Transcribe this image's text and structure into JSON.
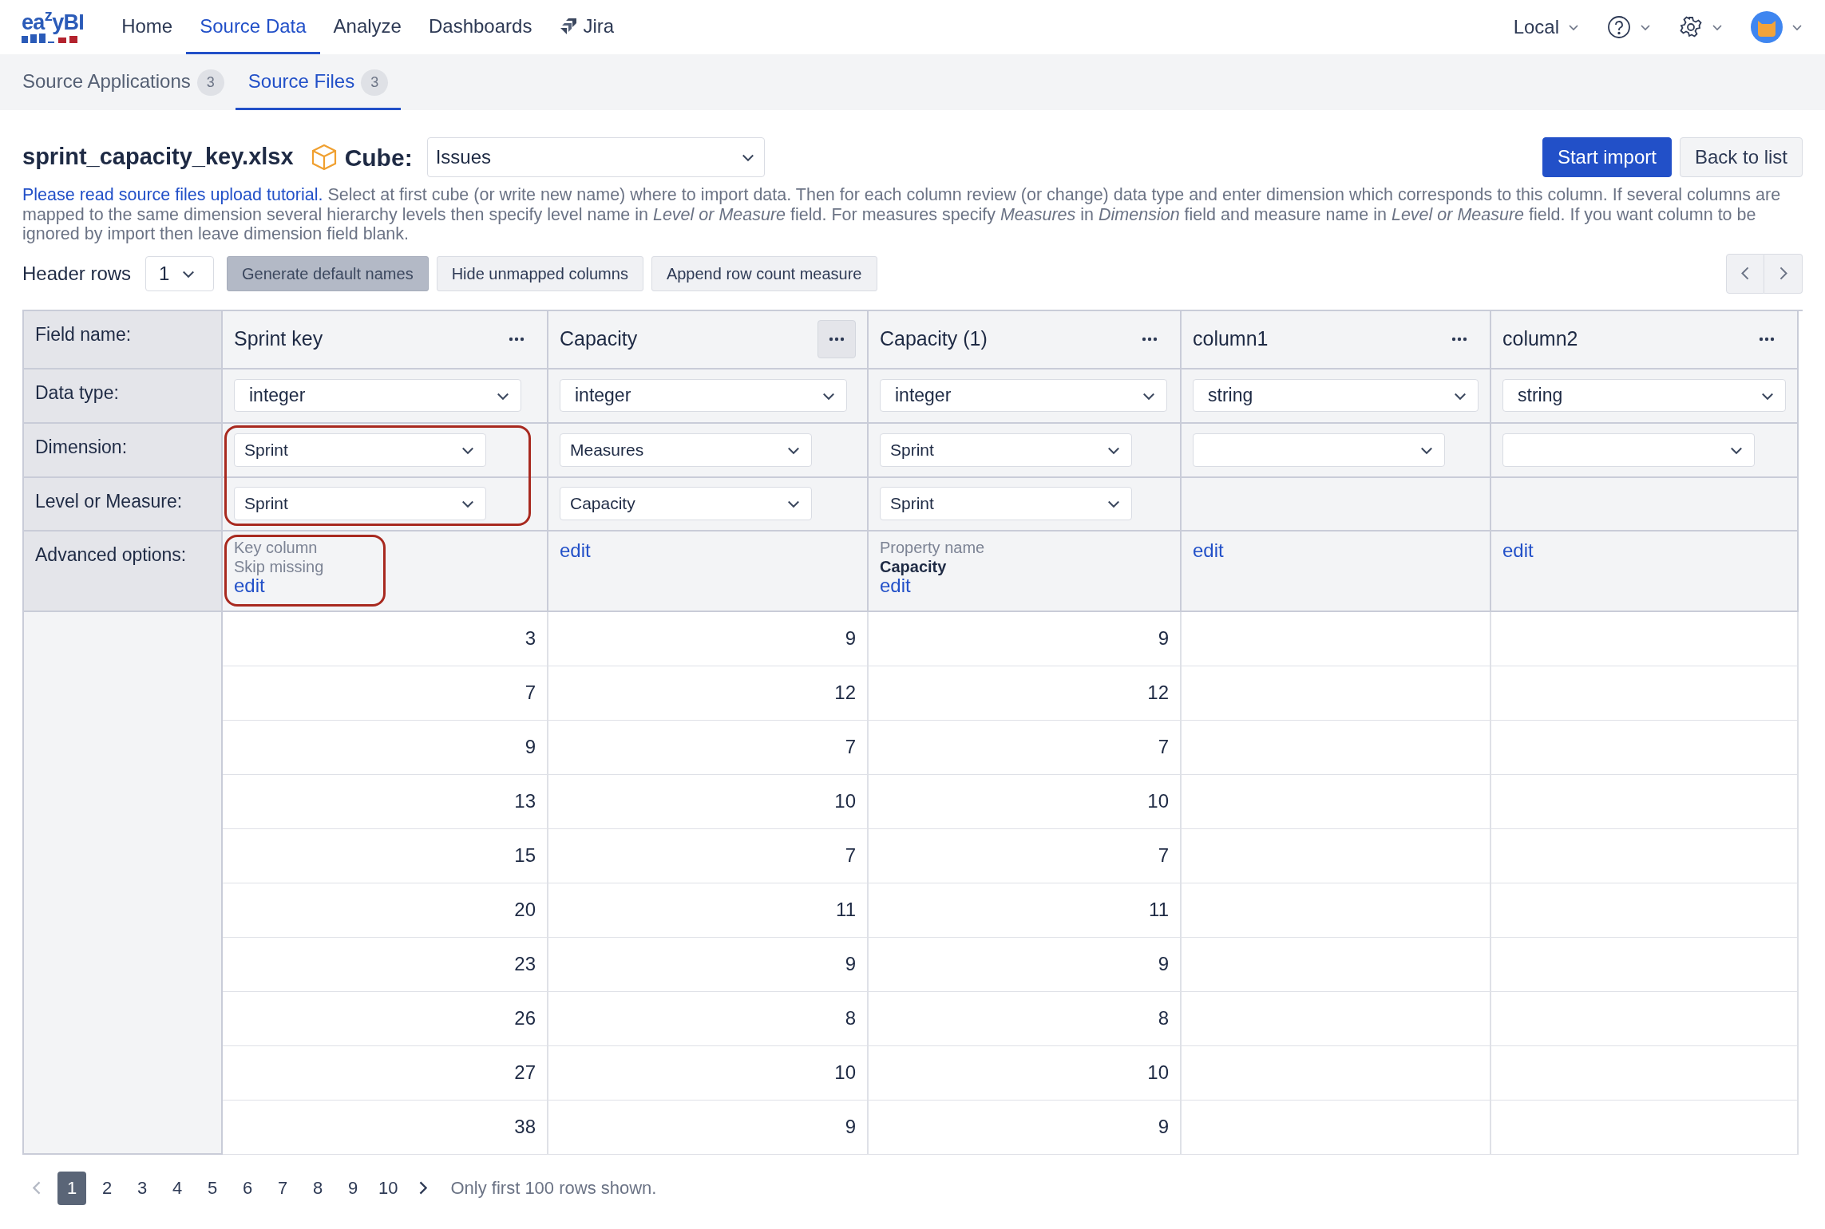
{
  "logo": "ea$^{z}$yBI",
  "nav": [
    {
      "label": "Home",
      "selected": false,
      "kind": "text"
    },
    {
      "label": "Source Data",
      "selected": true,
      "kind": "text"
    },
    {
      "label": "Analyze",
      "selected": false,
      "kind": "text"
    },
    {
      "label": "Dashboards",
      "selected": false,
      "kind": "text"
    },
    {
      "label": "Jira",
      "selected": false,
      "kind": "jira"
    }
  ],
  "account_menu": {
    "label": "Local"
  },
  "subtabs": [
    {
      "label": "Source Applications",
      "count": "3",
      "selected": false
    },
    {
      "label": "Source Files",
      "count": "3",
      "selected": true
    }
  ],
  "file_name": "sprint_capacity_key.xlsx",
  "cube": {
    "label": "Cube:",
    "value": "Issues"
  },
  "actions": [
    {
      "label": "Start import",
      "kind": "primary"
    },
    {
      "label": "Back to list",
      "kind": "secondary"
    }
  ],
  "help_link": "Please read source files upload tutorial.",
  "help_text": "Select at first cube (or write new name) where to import data. Then for each column review (or change) data type and enter dimension which corresponds to this column. If several columns are mapped to the same dimension several hierarchy levels then specify level name in *Level or Measure* field. For measures specify *Measures* in *Dimension* field and measure name in *Level or Measure* field. If you want column to be ignored by import then leave dimension field blank.",
  "header_rows": {
    "label": "Header rows",
    "value": "1"
  },
  "toolbar_buttons": [
    {
      "label": "Generate default names",
      "pressed": true
    },
    {
      "label": "Hide unmapped columns",
      "pressed": false
    },
    {
      "label": "Append row count measure",
      "pressed": false
    }
  ],
  "row_labels": [
    "Field name:",
    "Data type:",
    "Dimension:",
    "Level or Measure:",
    "Advanced options:"
  ],
  "columns": [
    {
      "name": "Sprint key",
      "menu_active": false,
      "data_type": "integer",
      "dimension": "Sprint",
      "level": "Sprint",
      "highlight_mapping": true,
      "highlight_advanced": true,
      "advanced": [
        {
          "kind": "note",
          "text": "Key column"
        },
        {
          "kind": "note",
          "text": "Skip missing"
        },
        {
          "kind": "link",
          "text": "edit"
        }
      ]
    },
    {
      "name": "Capacity",
      "menu_active": true,
      "data_type": "integer",
      "dimension": "Measures",
      "level": "Capacity",
      "highlight_mapping": false,
      "highlight_advanced": false,
      "advanced": [
        {
          "kind": "link",
          "text": "edit"
        }
      ]
    },
    {
      "name": "Capacity (1)",
      "menu_active": false,
      "data_type": "integer",
      "dimension": "Sprint",
      "level": "Sprint",
      "highlight_mapping": false,
      "highlight_advanced": false,
      "advanced": [
        {
          "kind": "note",
          "text": "Property name"
        },
        {
          "kind": "bold",
          "text": "Capacity"
        },
        {
          "kind": "link",
          "text": "edit"
        }
      ]
    },
    {
      "name": "column1",
      "menu_active": false,
      "data_type": "string",
      "highlight_mapping": false,
      "highlight_advanced": false,
      "advanced": [
        {
          "kind": "link",
          "text": "edit"
        }
      ]
    },
    {
      "name": "column2",
      "menu_active": false,
      "data_type": "string",
      "highlight_mapping": false,
      "highlight_advanced": false,
      "advanced": [
        {
          "kind": "link",
          "text": "edit"
        }
      ]
    }
  ],
  "rows": [
    [
      "3",
      "9",
      "9"
    ],
    [
      "7",
      "12",
      "12"
    ],
    [
      "9",
      "7",
      "7"
    ],
    [
      "13",
      "10",
      "10"
    ],
    [
      "15",
      "7",
      "7"
    ],
    [
      "20",
      "11",
      "11"
    ],
    [
      "23",
      "9",
      "9"
    ],
    [
      "26",
      "8",
      "8"
    ],
    [
      "27",
      "10",
      "10"
    ],
    [
      "38",
      "9",
      "9"
    ]
  ],
  "pagination": {
    "pages": [
      {
        "label": "1",
        "selected": true
      },
      {
        "label": "2",
        "selected": false
      },
      {
        "label": "3",
        "selected": false
      },
      {
        "label": "4",
        "selected": false
      },
      {
        "label": "5",
        "selected": false
      },
      {
        "label": "6",
        "selected": false
      },
      {
        "label": "7",
        "selected": false
      },
      {
        "label": "8",
        "selected": false
      },
      {
        "label": "9",
        "selected": false
      },
      {
        "label": "10",
        "selected": false
      }
    ],
    "note": "Only first 100 rows shown."
  }
}
